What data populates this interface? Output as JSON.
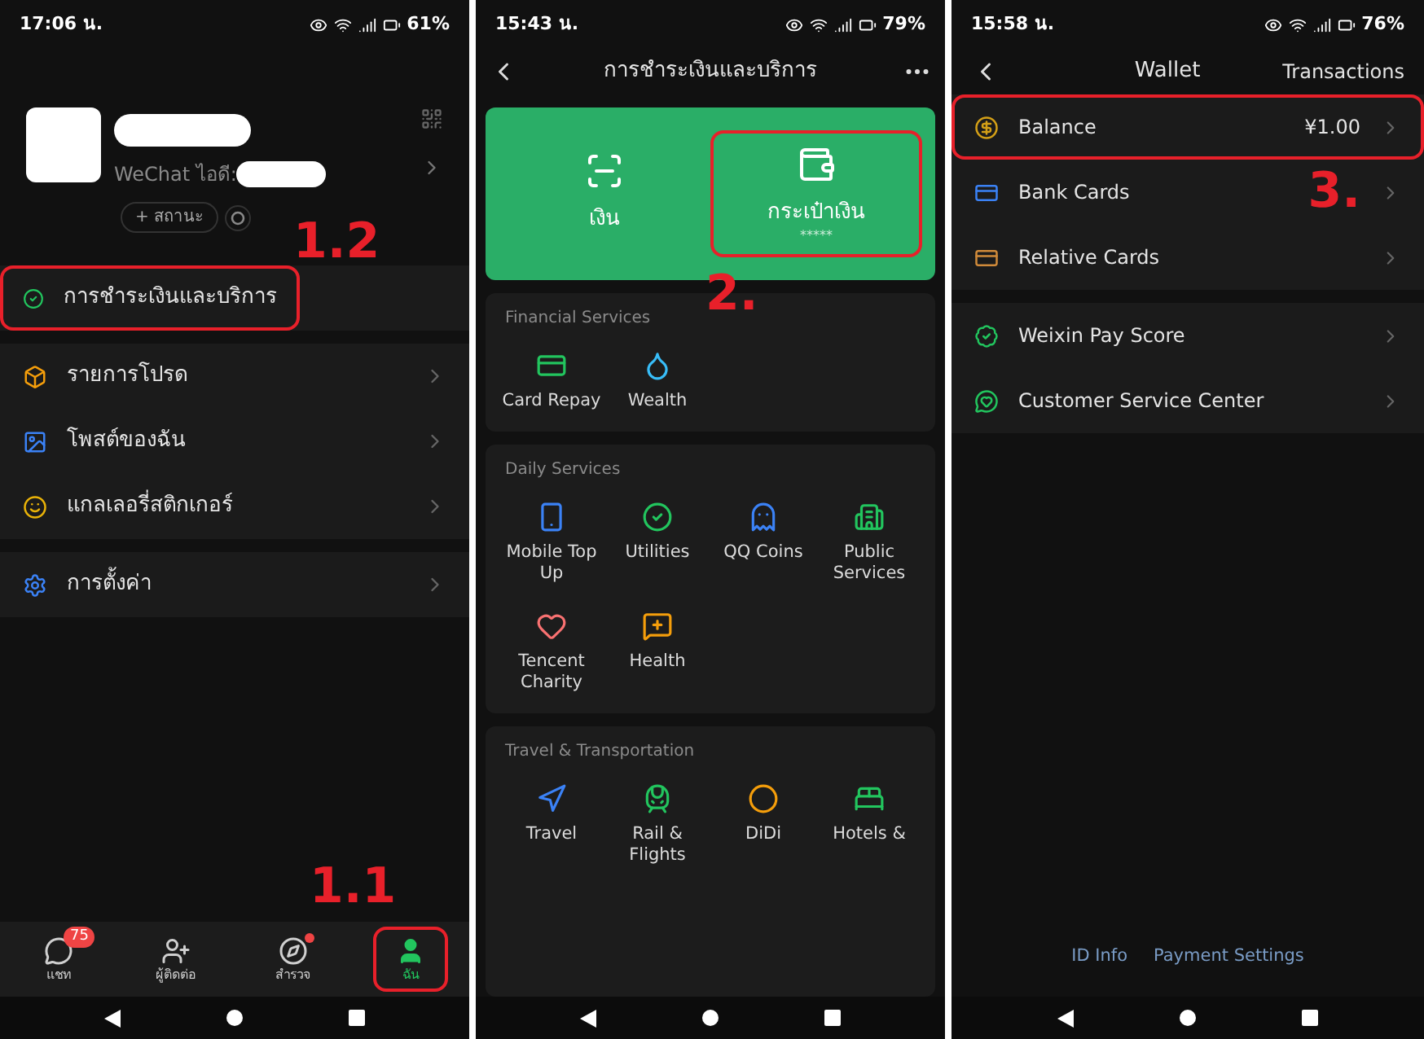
{
  "me_screen": {
    "status_bar": {
      "time": "17:06 น.",
      "battery": "61%"
    },
    "profile": {
      "id_label": "WeChat ไอดี:",
      "status_button": "+ สถานะ"
    },
    "menu_groups": [
      [
        {
          "label": "การชำระเงินและบริการ",
          "highlighted": true
        }
      ],
      [
        {
          "label": "รายการโปรด",
          "highlighted": false
        },
        {
          "label": "โพสต์ของฉัน",
          "highlighted": false
        },
        {
          "label": "แกลเลอรี่สติกเกอร์",
          "highlighted": false
        }
      ],
      [
        {
          "label": "การตั้งค่า",
          "highlighted": false
        }
      ]
    ],
    "tab_bar": [
      {
        "label": "แชท",
        "selected": false,
        "highlighted": false,
        "badge": "75",
        "dot": false
      },
      {
        "label": "ผู้ติดต่อ",
        "selected": false,
        "highlighted": false,
        "dot": false
      },
      {
        "label": "สำรวจ",
        "selected": false,
        "highlighted": false,
        "dot": true
      },
      {
        "label": "ฉัน",
        "selected": true,
        "highlighted": true,
        "dot": false
      }
    ],
    "callouts": [
      "1.2",
      "1.1"
    ]
  },
  "payment_screen": {
    "status_bar": {
      "time": "15:43 น.",
      "battery": "79%"
    },
    "header": {
      "title": "การชำระเงินและบริการ"
    },
    "top_actions": [
      {
        "label": "เงิน",
        "highlighted": false
      },
      {
        "label": "กระเป๋าเงิน",
        "sublabel": "*****",
        "highlighted": true
      }
    ],
    "sections": [
      {
        "title": "Financial Services",
        "items": [
          {
            "label": "Card Repay"
          },
          {
            "label": "Wealth"
          }
        ]
      },
      {
        "title": "Daily Services",
        "items": [
          {
            "label": "Mobile Top Up"
          },
          {
            "label": "Utilities"
          },
          {
            "label": "QQ Coins"
          },
          {
            "label": "Public Services"
          },
          {
            "label": "Tencent Charity"
          },
          {
            "label": "Health"
          }
        ]
      },
      {
        "title": "Travel & Transportation",
        "items": [
          {
            "label": "Travel"
          },
          {
            "label": "Rail & Flights"
          },
          {
            "label": "DiDi"
          },
          {
            "label": "Hotels &"
          }
        ]
      }
    ],
    "callouts": [
      "2."
    ]
  },
  "wallet_screen": {
    "status_bar": {
      "time": "15:58 น.",
      "battery": "76%"
    },
    "header": {
      "title": "Wallet",
      "action": "Transactions"
    },
    "groups": [
      [
        {
          "label": "Balance",
          "value": "¥1.00",
          "highlighted": true
        },
        {
          "label": "Bank Cards",
          "highlighted": false,
          "callout": "3."
        },
        {
          "label": "Relative Cards",
          "highlighted": false
        }
      ],
      [
        {
          "label": "Weixin Pay Score",
          "highlighted": false
        },
        {
          "label": "Customer Service Center",
          "highlighted": false
        }
      ]
    ],
    "footer_links": [
      "ID Info",
      "Payment Settings"
    ]
  }
}
